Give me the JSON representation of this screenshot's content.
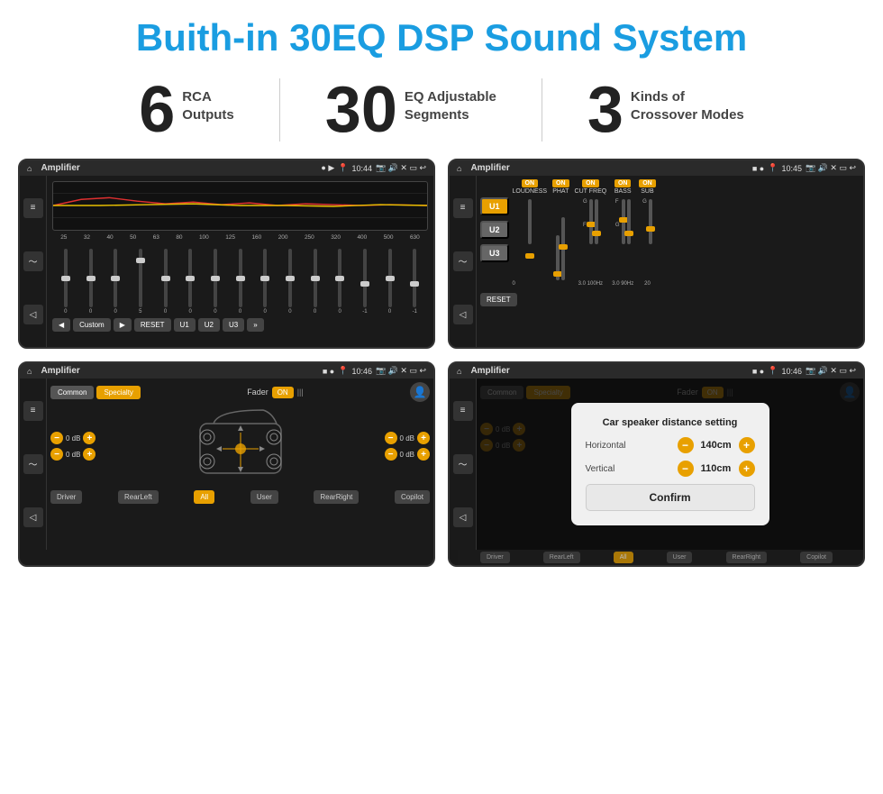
{
  "page": {
    "title": "Buith-in 30EQ DSP Sound System"
  },
  "stats": [
    {
      "number": "6",
      "label": "RCA\nOutputs"
    },
    {
      "number": "30",
      "label": "EQ Adjustable\nSegments"
    },
    {
      "number": "3",
      "label": "Kinds of\nCrossover Modes"
    }
  ],
  "screens": {
    "screen1": {
      "statusbar": {
        "title": "Amplifier",
        "time": "10:44"
      },
      "eq_freqs": [
        "25",
        "32",
        "40",
        "50",
        "63",
        "80",
        "100",
        "125",
        "160",
        "200",
        "250",
        "320",
        "400",
        "500",
        "630"
      ],
      "eq_values": [
        "0",
        "0",
        "0",
        "5",
        "0",
        "0",
        "0",
        "0",
        "0",
        "0",
        "0",
        "0",
        "-1",
        "0",
        "-1"
      ],
      "buttons": [
        "Custom",
        "RESET",
        "U1",
        "U2",
        "U3"
      ]
    },
    "screen2": {
      "statusbar": {
        "title": "Amplifier",
        "time": "10:45"
      },
      "units": [
        "U1",
        "U2",
        "U3"
      ],
      "sections": [
        "LOUDNESS",
        "PHAT",
        "CUT FREQ",
        "BASS",
        "SUB"
      ],
      "reset_btn": "RESET"
    },
    "screen3": {
      "statusbar": {
        "title": "Amplifier",
        "time": "10:46"
      },
      "tabs": [
        "Common",
        "Specialty"
      ],
      "fader_label": "Fader",
      "fader_toggle": "ON",
      "db_values": [
        "0 dB",
        "0 dB",
        "0 dB",
        "0 dB"
      ],
      "bottom_btns": [
        "Driver",
        "RearLeft",
        "All",
        "User",
        "RearRight",
        "Copilot"
      ]
    },
    "screen4": {
      "statusbar": {
        "title": "Amplifier",
        "time": "10:46"
      },
      "tabs": [
        "Common",
        "Specialty"
      ],
      "dialog": {
        "title": "Car speaker distance setting",
        "horizontal_label": "Horizontal",
        "horizontal_value": "140cm",
        "vertical_label": "Vertical",
        "vertical_value": "110cm",
        "confirm_btn": "Confirm"
      },
      "db_values": [
        "0 dB",
        "0 dB"
      ],
      "bottom_btns": [
        "Driver",
        "RearLeft",
        "All",
        "User",
        "RearRight",
        "Copilot"
      ]
    }
  }
}
